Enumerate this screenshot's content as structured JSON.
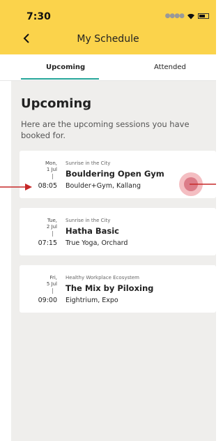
{
  "status_bar": {
    "time": "7:30"
  },
  "header": {
    "title": "My Schedule"
  },
  "tabs": [
    {
      "label": "Upcoming",
      "active": true
    },
    {
      "label": "Attended",
      "active": false
    }
  ],
  "page": {
    "title": "Upcoming",
    "intro": "Here are the upcoming sessions you have booked for."
  },
  "sessions": [
    {
      "day": "Mon,",
      "date": "1 Jul",
      "time": "08:05",
      "organizer": "Sunrise in the City",
      "name": "Bouldering Open Gym",
      "venue": "Boulder+Gym, Kallang"
    },
    {
      "day": "Tue,",
      "date": "2 Jul",
      "time": "07:15",
      "organizer": "Sunrise in the City",
      "name": "Hatha Basic",
      "venue": "True Yoga, Orchard"
    },
    {
      "day": "Fri,",
      "date": "5 Jul",
      "time": "09:00",
      "organizer": "Healthy Workplace Ecosystem",
      "name": "The Mix by Piloxing",
      "venue": "Eightrium, Expo"
    }
  ],
  "colors": {
    "header_bg": "#FBD34B",
    "tab_underline": "#26A69A",
    "annotation": "#C62828"
  }
}
